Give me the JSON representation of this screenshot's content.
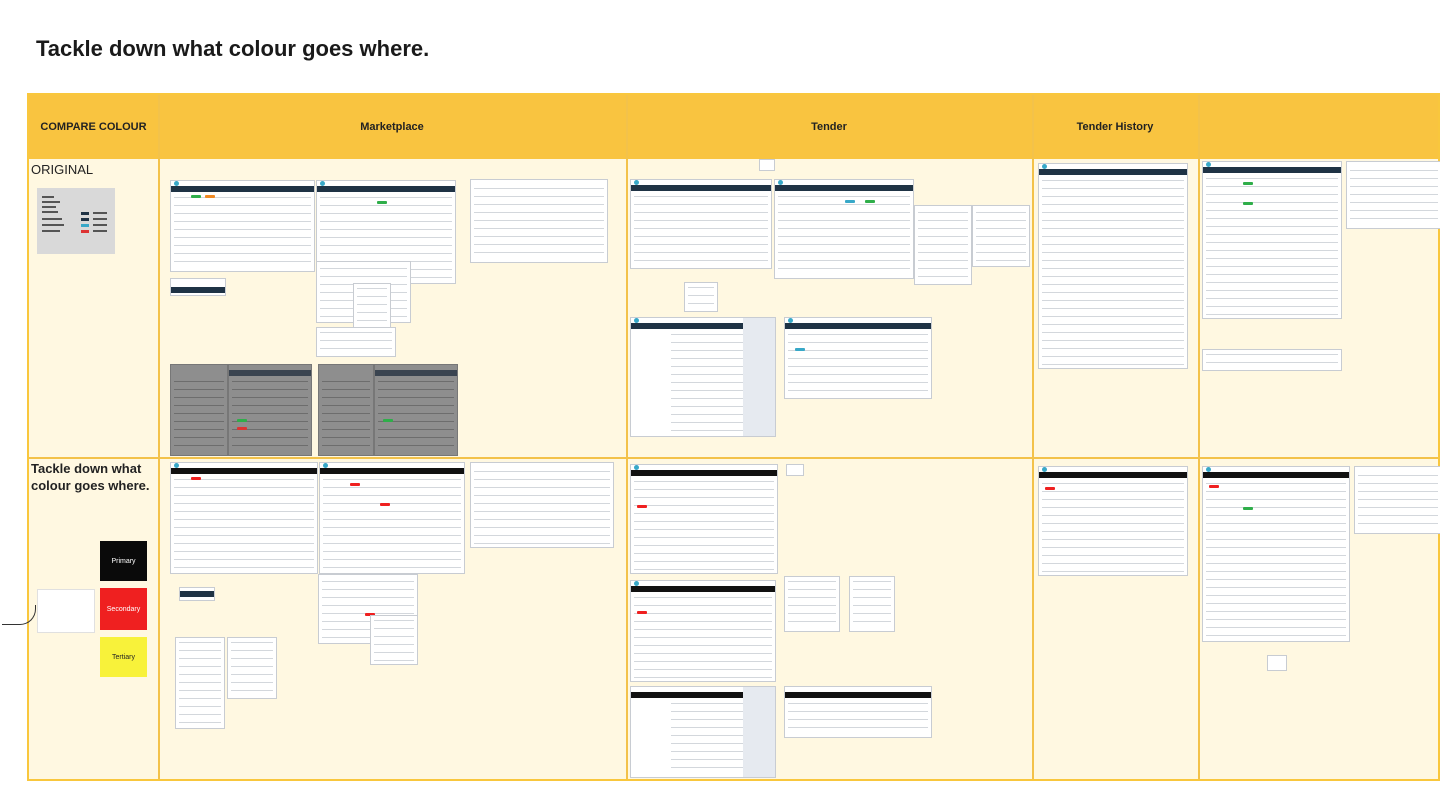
{
  "page": {
    "title": "Tackle down what colour goes where."
  },
  "board": {
    "header_cells": [
      {
        "label": "COMPARE COLOUR"
      },
      {
        "label": "Marketplace"
      },
      {
        "label": "Tender"
      },
      {
        "label": "Tender History"
      },
      {
        "label": ""
      }
    ],
    "rows": {
      "original_label": "ORIGINAL",
      "revised_label": "Tackle down what colour goes where."
    },
    "swatches": [
      {
        "label": "Primary",
        "color": "#0a0a0a"
      },
      {
        "label": "Secondary",
        "color": "#ef2020"
      },
      {
        "label": "Tertiary",
        "color": "#f8f23a"
      }
    ]
  },
  "colors": {
    "header_bg": "#f9c440",
    "board_bg": "#fff8e1",
    "border": "#f3c24a",
    "original_nav": "#1f3345",
    "revised_nav": "#111111",
    "accent_green": "#2fae4a",
    "accent_red": "#ef2020",
    "accent_blue": "#38a8c8"
  }
}
